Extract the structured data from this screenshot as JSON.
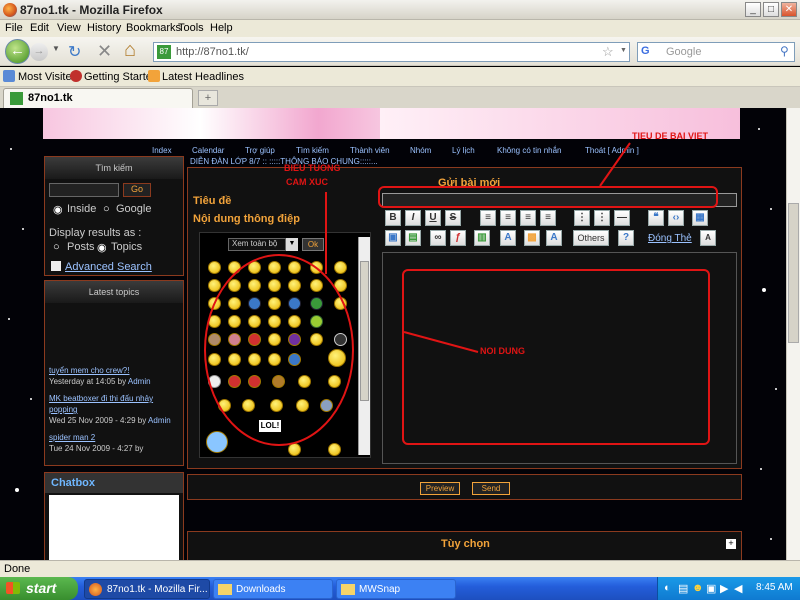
{
  "window": {
    "title": "87no1.tk - Mozilla Firefox",
    "min": "_",
    "max": "□",
    "close": "✕"
  },
  "menu": [
    "File",
    "Edit",
    "View",
    "History",
    "Bookmarks",
    "Tools",
    "Help"
  ],
  "nav": {
    "url": "http://87no1.tk/",
    "search_placeholder": "Google",
    "back": "←",
    "fwd": "→",
    "reload": "↻",
    "stop": "✕",
    "home": "⌂"
  },
  "bookmarks": [
    "Most Visited",
    "Getting Started",
    "Latest Headlines"
  ],
  "tabs": {
    "active": "87no1.tk",
    "new": "+"
  },
  "forum": {
    "nav_links": [
      "Index",
      "Calendar",
      "Trợ giúp",
      "Tìm kiếm",
      "Thành viên",
      "Nhóm",
      "Lý lịch",
      "Không có tin nhắn",
      "Thoát [ Admin ]"
    ],
    "breadcrumb": "DIỄN ĐÀN LỚP 8/7 :: :::::THÔNG BÁO CHUNG:::::..."
  },
  "sidebar": {
    "search": {
      "title": "Tìm kiếm",
      "go": "Go",
      "inside": "Inside",
      "google": "Google",
      "display_as": "Display results as :",
      "posts": "Posts",
      "topics": "Topics",
      "advanced": "Advanced Search"
    },
    "latest": {
      "title": "Latest topics",
      "items": [
        {
          "title": "tuyển mem cho crew?!",
          "meta": "Yesterday at 14:05 by",
          "author": "Admin"
        },
        {
          "title": "MK beatboxer đi thi đấu nhảy popping",
          "meta": "Wed 25 Nov 2009 - 4:29 by",
          "author": "Admin"
        },
        {
          "title": "spider man 2",
          "meta": "Tue 24 Nov 2009 - 4:27 by",
          "author": ""
        }
      ]
    },
    "chatbox": {
      "title": "Chatbox"
    }
  },
  "editor": {
    "header": "Gửi bài mới",
    "subject_label": "Tiêu đề",
    "message_label": "Nội dung thông điệp",
    "smiley_select": "Xem toàn bộ",
    "smiley_ok": "Ok",
    "buttons": [
      "B",
      "I",
      "U",
      "S",
      "Others",
      "Đóng Thẻ"
    ],
    "preview": "Preview",
    "send": "Send",
    "options": "Tùy chọn",
    "options_toggle": "+",
    "lol": "LOL!"
  },
  "annotations": {
    "title": "TIEU DE BAI VIET",
    "emo_top": "BIEU TUONG",
    "emo": "CAM XUC",
    "content": "NOI DUNG"
  },
  "status": {
    "text": "Done"
  },
  "taskbar": {
    "start": "start",
    "items": [
      "87no1.tk - Mozilla Fir...",
      "Downloads",
      "MWSnap"
    ],
    "clock": "8:45 AM"
  },
  "colors": {
    "accent_orange": "#f2a33a",
    "annotation_red": "#e01414",
    "panel_border": "#8b3a1e",
    "link_blue": "#9bc2ff"
  }
}
